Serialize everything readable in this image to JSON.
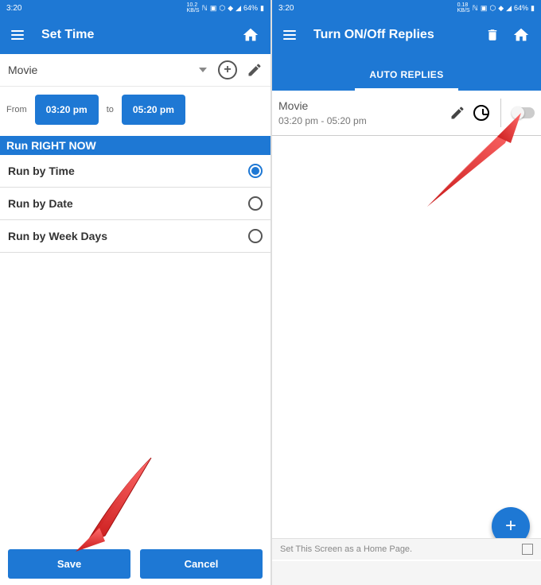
{
  "status": {
    "time": "3:20",
    "kbs1": "10.2",
    "kbs2": "0.18",
    "kbs_label": "KB/S",
    "battery": "64%"
  },
  "left": {
    "title": "Set Time",
    "dropdown": "Movie",
    "from_label": "From",
    "from_time": "03:20 pm",
    "to_label": "to",
    "to_time": "05:20 pm",
    "run_now": "Run RIGHT NOW",
    "options": [
      "Run by Time",
      "Run by Date",
      "Run by Week Days"
    ],
    "selected_index": 0,
    "save": "Save",
    "cancel": "Cancel"
  },
  "right": {
    "title": "Turn ON/Off Replies",
    "tab": "AUTO REPLIES",
    "item_title": "Movie",
    "item_time": "03:20 pm - 05:20 pm",
    "home_label": "Set This Screen as a Home Page."
  }
}
